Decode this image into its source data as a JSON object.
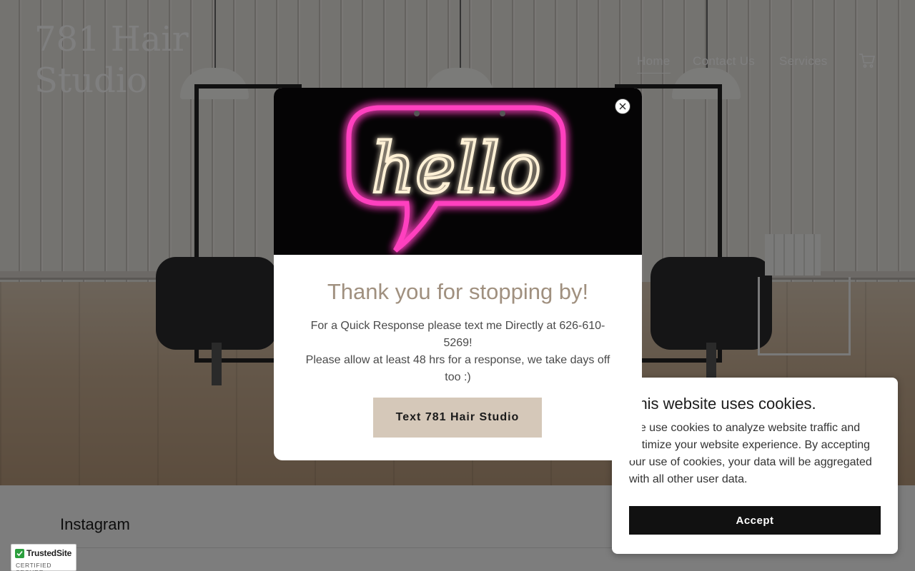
{
  "header": {
    "logo_line1": "781 Hair",
    "logo_line2": "Studio",
    "nav": [
      {
        "label": "Home",
        "active": true
      },
      {
        "label": "Contact Us",
        "active": false
      },
      {
        "label": "Services",
        "active": false
      }
    ],
    "cart_icon": "shopping-cart-icon"
  },
  "section": {
    "title": "Instagram"
  },
  "modal": {
    "image_text": "hello",
    "title": "Thank you for stopping by!",
    "line1": "For a Quick Response please text me Directly at 626-610-5269!",
    "line2": "Please allow at least 48 hrs for a response, we take days off too :)",
    "button_label": "Text 781 Hair Studio",
    "close_icon": "close-icon"
  },
  "cookie_banner": {
    "title": "This website uses cookies.",
    "text": "We use cookies to analyze website traffic and optimize your website experience. By accepting our use of cookies, your data will be aggregated with all other user data.",
    "accept_label": "Accept"
  },
  "badge": {
    "name": "TrustedSite",
    "subtitle": "CERTIFIED SECURE"
  },
  "colors": {
    "modal_title": "#a0907f",
    "modal_button": "#d5c8b9",
    "neon_pink": "#ff3fbf",
    "neon_warm": "#fff1d6",
    "cookie_button": "#111111",
    "badge_check": "#2b9f3d"
  }
}
